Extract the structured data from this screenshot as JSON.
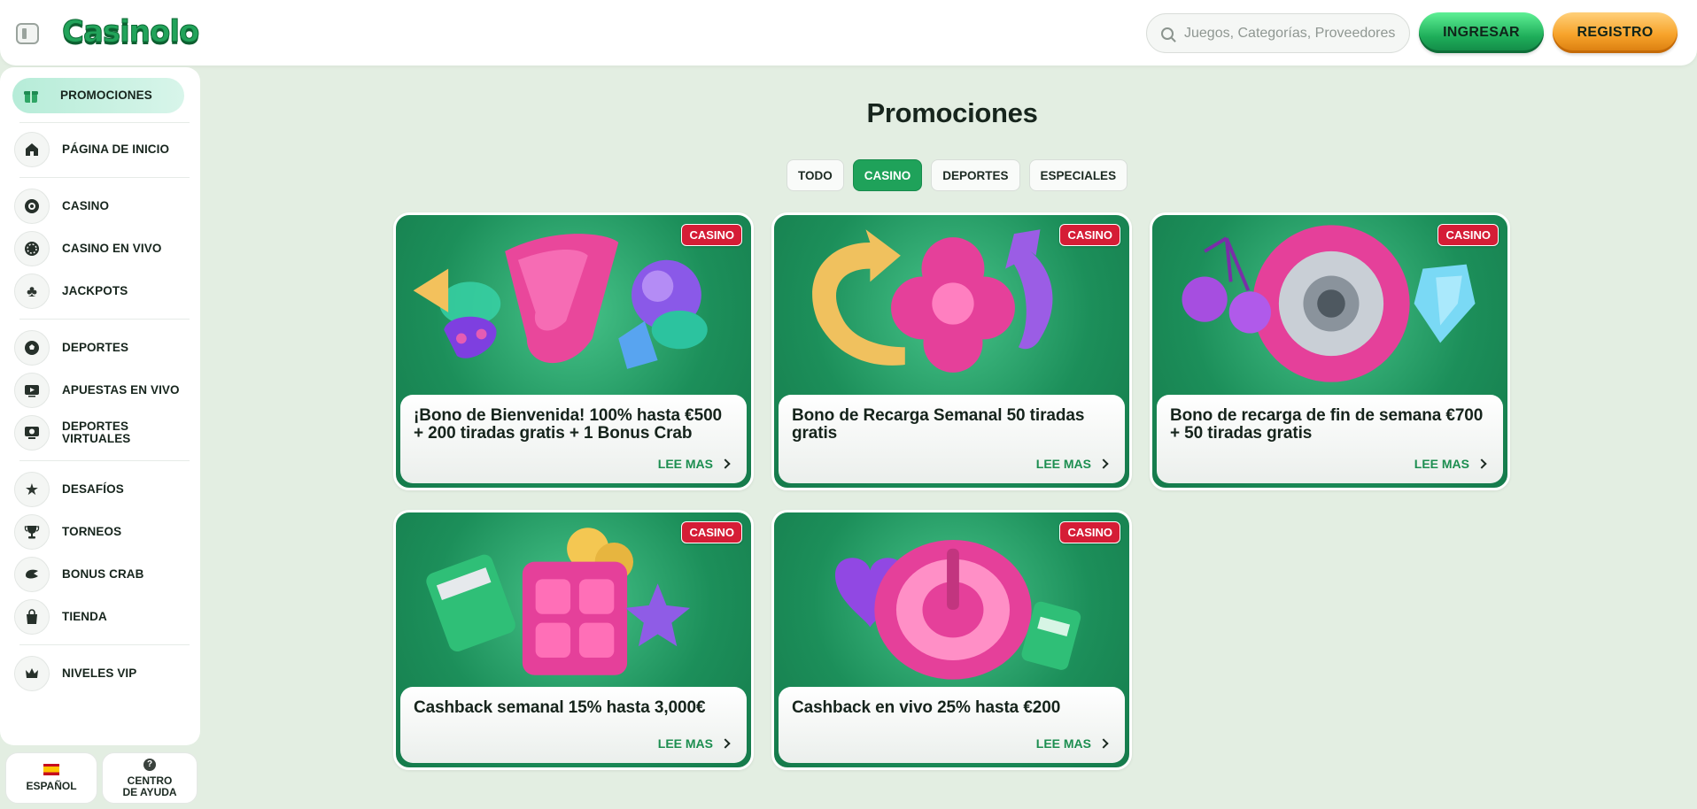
{
  "header": {
    "logo": "Casinolo",
    "search_placeholder": "Juegos, Categorías, Proveedores",
    "login_label": "INGRESAR",
    "register_label": "REGISTRO"
  },
  "sidebar": {
    "items": [
      {
        "label": "PROMOCIONES",
        "icon": "gift-icon",
        "active": true
      },
      {
        "label": "PÁGINA DE INICIO",
        "icon": "home-icon"
      },
      {
        "label": "CASINO",
        "icon": "chip-icon"
      },
      {
        "label": "CASINO EN VIVO",
        "icon": "live-casino-icon"
      },
      {
        "label": "JACKPOTS",
        "icon": "club-icon"
      },
      {
        "label": "DEPORTES",
        "icon": "soccer-ball-icon"
      },
      {
        "label": "APUESTAS EN VIVO",
        "icon": "live-bet-icon"
      },
      {
        "label": "DEPORTES VIRTUALES",
        "icon": "virtual-sports-icon"
      },
      {
        "label": "DESAFÍOS",
        "icon": "star-icon"
      },
      {
        "label": "TORNEOS",
        "icon": "trophy-icon"
      },
      {
        "label": "BONUS CRAB",
        "icon": "claw-icon"
      },
      {
        "label": "TIENDA",
        "icon": "bag-icon"
      },
      {
        "label": "NIVELES VIP",
        "icon": "crown-icon"
      }
    ],
    "language_label": "ESPAÑOL",
    "help_label": "CENTRO DE AYUDA"
  },
  "main": {
    "title": "Promociones",
    "filters": [
      {
        "label": "TODO",
        "active": false
      },
      {
        "label": "CASINO",
        "active": true
      },
      {
        "label": "DEPORTES",
        "active": false
      },
      {
        "label": "ESPECIALES",
        "active": false
      }
    ],
    "cards": [
      {
        "badge": "CASINO",
        "title": "¡Bono de Bienvenida! 100% hasta €500 + 200 tiradas gratis + 1 Bonus Crab",
        "cta": "LEE MAS"
      },
      {
        "badge": "CASINO",
        "title": "Bono de Recarga Semanal 50 tiradas gratis",
        "cta": "LEE MAS"
      },
      {
        "badge": "CASINO",
        "title": "Bono de recarga de fin de semana €700 + 50 tiradas gratis",
        "cta": "LEE MAS"
      },
      {
        "badge": "CASINO",
        "title": "Cashback semanal 15% hasta 3,000€",
        "cta": "LEE MAS"
      },
      {
        "badge": "CASINO",
        "title": "Cashback en vivo 25% hasta €200",
        "cta": "LEE MAS"
      }
    ]
  },
  "colors": {
    "brand_green": "#22a35a",
    "login_button": "#1ead59",
    "register_button": "#f7a32a",
    "badge_red": "#d51d36",
    "background": "#e3eee2"
  }
}
